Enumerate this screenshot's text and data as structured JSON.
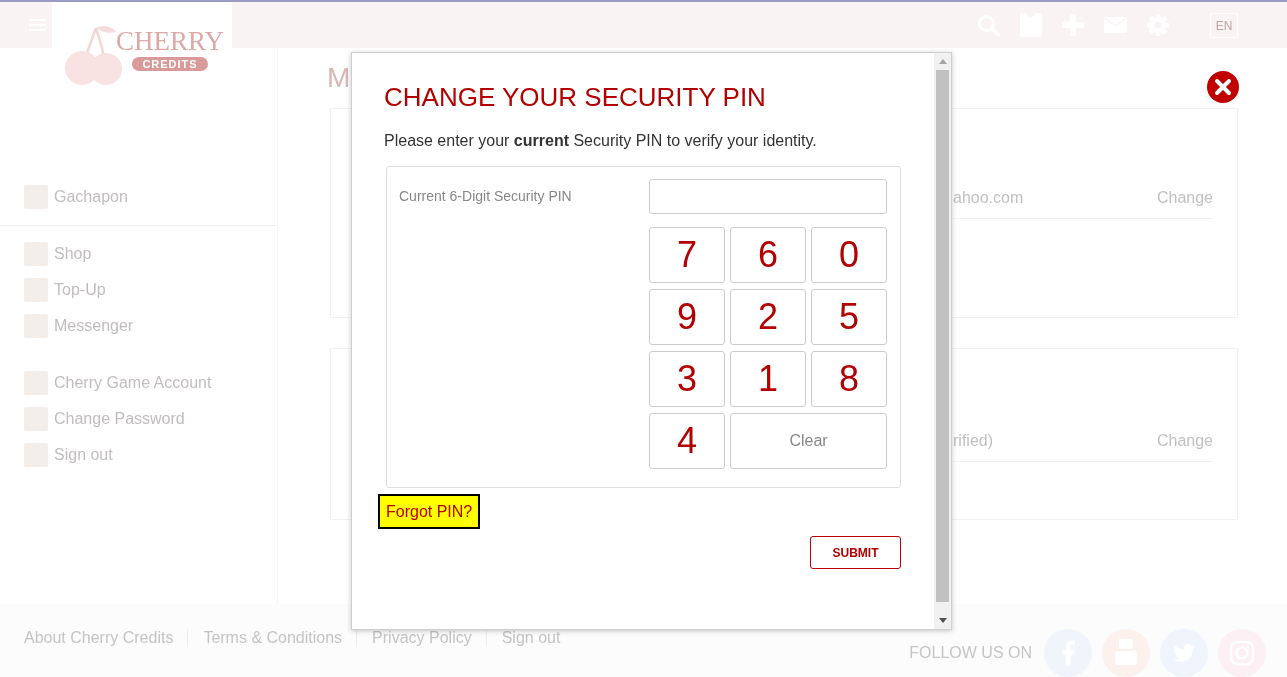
{
  "header": {
    "logo": {
      "name": "CHERRY",
      "tagline": "CREDITS"
    },
    "language": "EN"
  },
  "sidebar": {
    "groups": [
      {
        "separator_below": true,
        "items": [
          {
            "label": "Gachapon"
          }
        ]
      },
      {
        "separator_below": false,
        "items": [
          {
            "label": "Shop"
          },
          {
            "label": "Top-Up"
          },
          {
            "label": "Messenger"
          }
        ]
      },
      {
        "separator_below": false,
        "items": [
          {
            "label": "Cherry Game Account"
          },
          {
            "label": "Change Password"
          },
          {
            "label": "Sign out"
          }
        ]
      }
    ]
  },
  "content": {
    "heading": "M",
    "cards": [
      {
        "rows": [
          {
            "value": "ahoo.com",
            "action": "Change"
          }
        ]
      },
      {
        "rows": [
          {
            "value": "rified)",
            "action": "Change"
          }
        ]
      }
    ]
  },
  "dialog": {
    "title": "CHANGE YOUR SECURITY PIN",
    "instruction": "Please enter your **current** Security PIN to verify your identity.",
    "pin_label": "Current 6-Digit Security PIN",
    "keypad": [
      {
        "kind": "digit",
        "label": "7"
      },
      {
        "kind": "digit",
        "label": "6"
      },
      {
        "kind": "digit",
        "label": "0"
      },
      {
        "kind": "digit",
        "label": "9"
      },
      {
        "kind": "digit",
        "label": "2"
      },
      {
        "kind": "digit",
        "label": "5"
      },
      {
        "kind": "digit",
        "label": "3"
      },
      {
        "kind": "digit",
        "label": "1"
      },
      {
        "kind": "digit",
        "label": "8"
      },
      {
        "kind": "digit",
        "label": "4"
      },
      {
        "kind": "clear",
        "label": "Clear"
      }
    ],
    "forgot_link": {
      "label": "Forgot PIN?",
      "highlighted": true
    },
    "submit_label": "SUBMIT"
  },
  "footer": {
    "links": [
      "About Cherry Credits",
      "Terms & Conditions",
      "Privacy Policy",
      "Sign out"
    ],
    "follow_label": "FOLLOW US ON",
    "social": [
      {
        "kind": "facebook",
        "color": "#f2f4fb"
      },
      {
        "kind": "youtube",
        "color": "#fdf1ee"
      },
      {
        "kind": "twitter",
        "color": "#f0f4fc"
      },
      {
        "kind": "instagram",
        "color": "#fcf0f4"
      }
    ]
  }
}
